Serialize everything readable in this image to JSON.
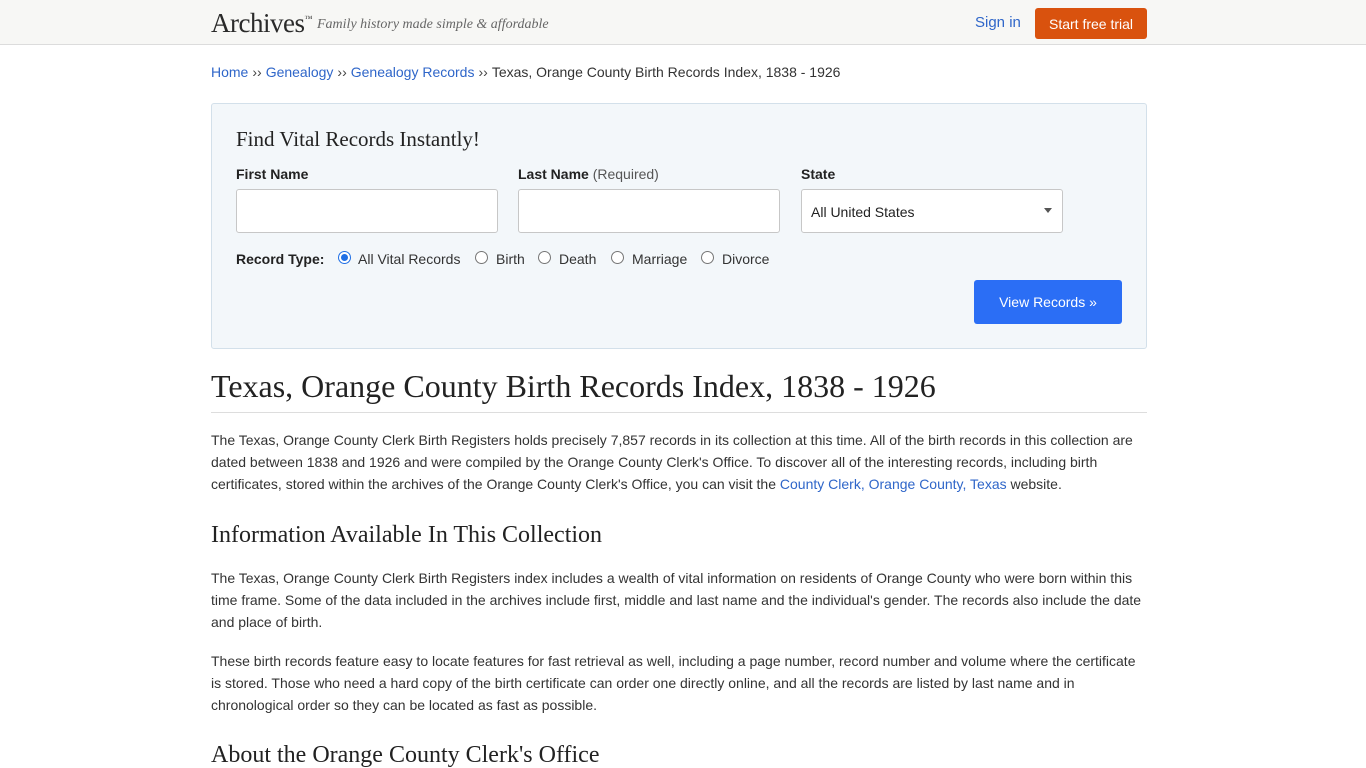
{
  "header": {
    "logo": "Archives",
    "logo_mark": "™",
    "tagline": "Family history made simple & affordable",
    "sign_in": "Sign in",
    "trial_button": "Start free trial"
  },
  "breadcrumb": {
    "items": [
      "Home",
      "Genealogy",
      "Genealogy Records"
    ],
    "separator": "››",
    "current": "Texas, Orange County Birth Records Index, 1838 - 1926"
  },
  "search": {
    "title": "Find Vital Records Instantly!",
    "first_name_label": "First Name",
    "first_name_value": "",
    "last_name_label": "Last Name",
    "last_name_note": "(Required)",
    "last_name_value": "",
    "state_label": "State",
    "state_value": "All United States",
    "record_type_label": "Record Type:",
    "record_types": [
      "All Vital Records",
      "Birth",
      "Death",
      "Marriage",
      "Divorce"
    ],
    "selected_record_type": "All Vital Records",
    "submit": "View Records »"
  },
  "article": {
    "title": "Texas, Orange County Birth Records Index, 1838 - 1926",
    "intro_text": "The Texas, Orange County Clerk Birth Registers holds precisely 7,857 records in its collection at this time. All of the birth records in this collection are dated between 1838 and 1926 and were compiled by the Orange County Clerk's Office. To discover all of the interesting records, including birth certificates, stored within the archives of the Orange County Clerk's Office, you can visit the ",
    "intro_link": "County Clerk, Orange County, Texas",
    "intro_end": " website.",
    "section1_heading": "Information Available In This Collection",
    "section1_p1": "The Texas, Orange County Clerk Birth Registers index includes a wealth of vital information on residents of Orange County who were born within this time frame. Some of the data included in the archives include first, middle and last name and the individual's gender. The records also include the date and place of birth.",
    "section1_p2": "These birth records feature easy to locate features for fast retrieval as well, including a page number, record number and volume where the certificate is stored. Those who need a hard copy of the birth certificate can order one directly online, and all the records are listed by last name and in chronological order so they can be located as fast as possible.",
    "section2_heading": "About the Orange County Clerk's Office"
  },
  "colors": {
    "accent_orange": "#d9520e",
    "button_blue": "#2b6ef5",
    "link_blue": "#2f66c9",
    "panel_bg": "#f3f7fa"
  }
}
